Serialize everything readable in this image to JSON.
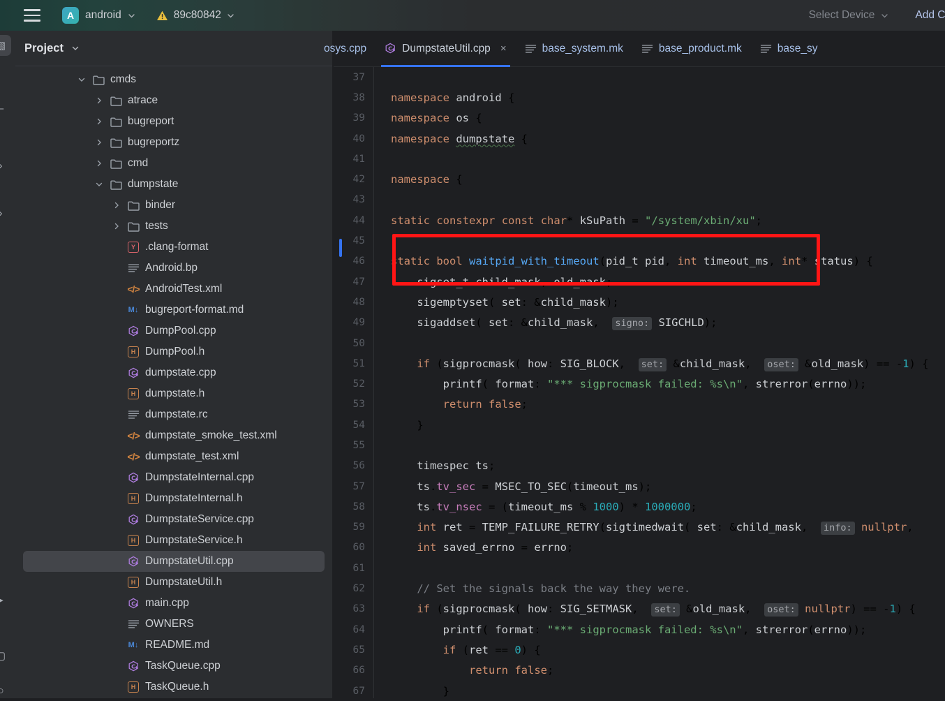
{
  "toolbar": {
    "menu_icon": "hamburger-icon",
    "project_badge": "A",
    "project_name": "android",
    "warning_icon": "warning-triangle-icon",
    "branch_name": "89c80842",
    "select_device": "Select Device",
    "add_configuration": "Add Conf"
  },
  "activity_strip": {
    "items": [
      {
        "name": "project-tool-window",
        "glyph": "▧",
        "selected": true
      },
      {
        "name": "commit-tool-window",
        "glyph": "–",
        "selected": false
      },
      {
        "name": "pull-requests-tool-window",
        "glyph": "›",
        "selected": false
      },
      {
        "name": "bookmarks-tool-window",
        "glyph": "›",
        "selected": false
      },
      {
        "name": "run-tool-window",
        "glyph": "▸",
        "selected": false
      },
      {
        "name": "terminal-tool-window",
        "glyph": "▢",
        "selected": false
      },
      {
        "name": "problems-tool-window",
        "glyph": "○",
        "selected": false
      }
    ]
  },
  "project_panel": {
    "title": "Project",
    "tree": [
      {
        "label": "cmds",
        "indent": 0,
        "kind": "folder",
        "state": "expanded"
      },
      {
        "label": "atrace",
        "indent": 1,
        "kind": "folder",
        "state": "collapsed"
      },
      {
        "label": "bugreport",
        "indent": 1,
        "kind": "folder",
        "state": "collapsed"
      },
      {
        "label": "bugreportz",
        "indent": 1,
        "kind": "folder",
        "state": "collapsed"
      },
      {
        "label": "cmd",
        "indent": 1,
        "kind": "folder",
        "state": "collapsed"
      },
      {
        "label": "dumpstate",
        "indent": 1,
        "kind": "folder",
        "state": "expanded"
      },
      {
        "label": "binder",
        "indent": 2,
        "kind": "folder",
        "state": "collapsed"
      },
      {
        "label": "tests",
        "indent": 2,
        "kind": "folder",
        "state": "collapsed"
      },
      {
        "label": ".clang-format",
        "indent": 2,
        "kind": "yaml"
      },
      {
        "label": "Android.bp",
        "indent": 2,
        "kind": "text"
      },
      {
        "label": "AndroidTest.xml",
        "indent": 2,
        "kind": "xml"
      },
      {
        "label": "bugreport-format.md",
        "indent": 2,
        "kind": "md"
      },
      {
        "label": "DumpPool.cpp",
        "indent": 2,
        "kind": "cpp"
      },
      {
        "label": "DumpPool.h",
        "indent": 2,
        "kind": "header"
      },
      {
        "label": "dumpstate.cpp",
        "indent": 2,
        "kind": "cpp"
      },
      {
        "label": "dumpstate.h",
        "indent": 2,
        "kind": "header"
      },
      {
        "label": "dumpstate.rc",
        "indent": 2,
        "kind": "text"
      },
      {
        "label": "dumpstate_smoke_test.xml",
        "indent": 2,
        "kind": "xml"
      },
      {
        "label": "dumpstate_test.xml",
        "indent": 2,
        "kind": "xml"
      },
      {
        "label": "DumpstateInternal.cpp",
        "indent": 2,
        "kind": "cpp"
      },
      {
        "label": "DumpstateInternal.h",
        "indent": 2,
        "kind": "header"
      },
      {
        "label": "DumpstateService.cpp",
        "indent": 2,
        "kind": "cpp"
      },
      {
        "label": "DumpstateService.h",
        "indent": 2,
        "kind": "header"
      },
      {
        "label": "DumpstateUtil.cpp",
        "indent": 2,
        "kind": "cpp",
        "selected": true
      },
      {
        "label": "DumpstateUtil.h",
        "indent": 2,
        "kind": "header"
      },
      {
        "label": "main.cpp",
        "indent": 2,
        "kind": "cpp"
      },
      {
        "label": "OWNERS",
        "indent": 2,
        "kind": "text"
      },
      {
        "label": "README.md",
        "indent": 2,
        "kind": "md"
      },
      {
        "label": "TaskQueue.cpp",
        "indent": 2,
        "kind": "cpp"
      },
      {
        "label": "TaskQueue.h",
        "indent": 2,
        "kind": "header"
      }
    ]
  },
  "editor": {
    "tabs": [
      {
        "label": "osys.cpp",
        "kind": "cpp",
        "active": false,
        "truncated": true
      },
      {
        "label": "DumpstateUtil.cpp",
        "kind": "cpp",
        "active": true,
        "closable": true,
        "close_glyph": "×"
      },
      {
        "label": "base_system.mk",
        "kind": "text",
        "active": false
      },
      {
        "label": "base_product.mk",
        "kind": "text",
        "active": false
      },
      {
        "label": "base_sy",
        "kind": "text",
        "active": false,
        "truncated": true
      }
    ],
    "first_line_number": 37,
    "lines": [
      {
        "n": 37,
        "text": ""
      },
      {
        "n": 38,
        "text": "namespace android {"
      },
      {
        "n": 39,
        "text": "namespace os {"
      },
      {
        "n": 40,
        "text": "namespace dumpstate {"
      },
      {
        "n": 41,
        "text": ""
      },
      {
        "n": 42,
        "text": "namespace {"
      },
      {
        "n": 43,
        "text": ""
      },
      {
        "n": 44,
        "text": "static constexpr const char* kSuPath = \"/system/xbin/xu\";"
      },
      {
        "n": 45,
        "text": ""
      },
      {
        "n": 46,
        "text": "static bool waitpid_with_timeout(pid_t pid, int timeout_ms, int* status) {"
      },
      {
        "n": 47,
        "text": "    sigset_t child_mask, old_mask;"
      },
      {
        "n": 48,
        "text": "    sigemptyset( set: &child_mask);"
      },
      {
        "n": 49,
        "text": "    sigaddset( set: &child_mask,  signo: SIGCHLD);"
      },
      {
        "n": 50,
        "text": ""
      },
      {
        "n": 51,
        "text": "    if (sigprocmask( how: SIG_BLOCK,  set: &child_mask,  oset: &old_mask) == -1) {"
      },
      {
        "n": 52,
        "text": "        printf( format: \"*** sigprocmask failed: %s\\n\", strerror(errno));"
      },
      {
        "n": 53,
        "text": "        return false;"
      },
      {
        "n": 54,
        "text": "    }"
      },
      {
        "n": 55,
        "text": ""
      },
      {
        "n": 56,
        "text": "    timespec ts;"
      },
      {
        "n": 57,
        "text": "    ts.tv_sec = MSEC_TO_SEC(timeout_ms);"
      },
      {
        "n": 58,
        "text": "    ts.tv_nsec = (timeout_ms % 1000) * 1000000;"
      },
      {
        "n": 59,
        "text": "    int ret = TEMP_FAILURE_RETRY(sigtimedwait( set: &child_mask,  info: nullptr,"
      },
      {
        "n": 60,
        "text": "    int saved_errno = errno;"
      },
      {
        "n": 61,
        "text": ""
      },
      {
        "n": 62,
        "text": "    // Set the signals back the way they were."
      },
      {
        "n": 63,
        "text": "    if (sigprocmask( how: SIG_SETMASK,  set: &old_mask,  oset: nullptr) == -1) {"
      },
      {
        "n": 64,
        "text": "        printf( format: \"*** sigprocmask failed: %s\\n\", strerror(errno));"
      },
      {
        "n": 65,
        "text": "        if (ret == 0) {"
      },
      {
        "n": 66,
        "text": "            return false;"
      },
      {
        "n": 67,
        "text": "        }"
      }
    ],
    "annotation": {
      "name": "red-highlight-box",
      "color": "#ff1515",
      "targets_line": 44
    }
  },
  "colors": {
    "accent_blue": "#3573f0",
    "annotation_red": "#ff1515",
    "toolbar_teal": "#1d3c38",
    "panel_bg": "#2b2d30",
    "editor_bg": "#1e1f22",
    "selection_bg": "#43454a",
    "link_blue": "#7aa7e8"
  }
}
